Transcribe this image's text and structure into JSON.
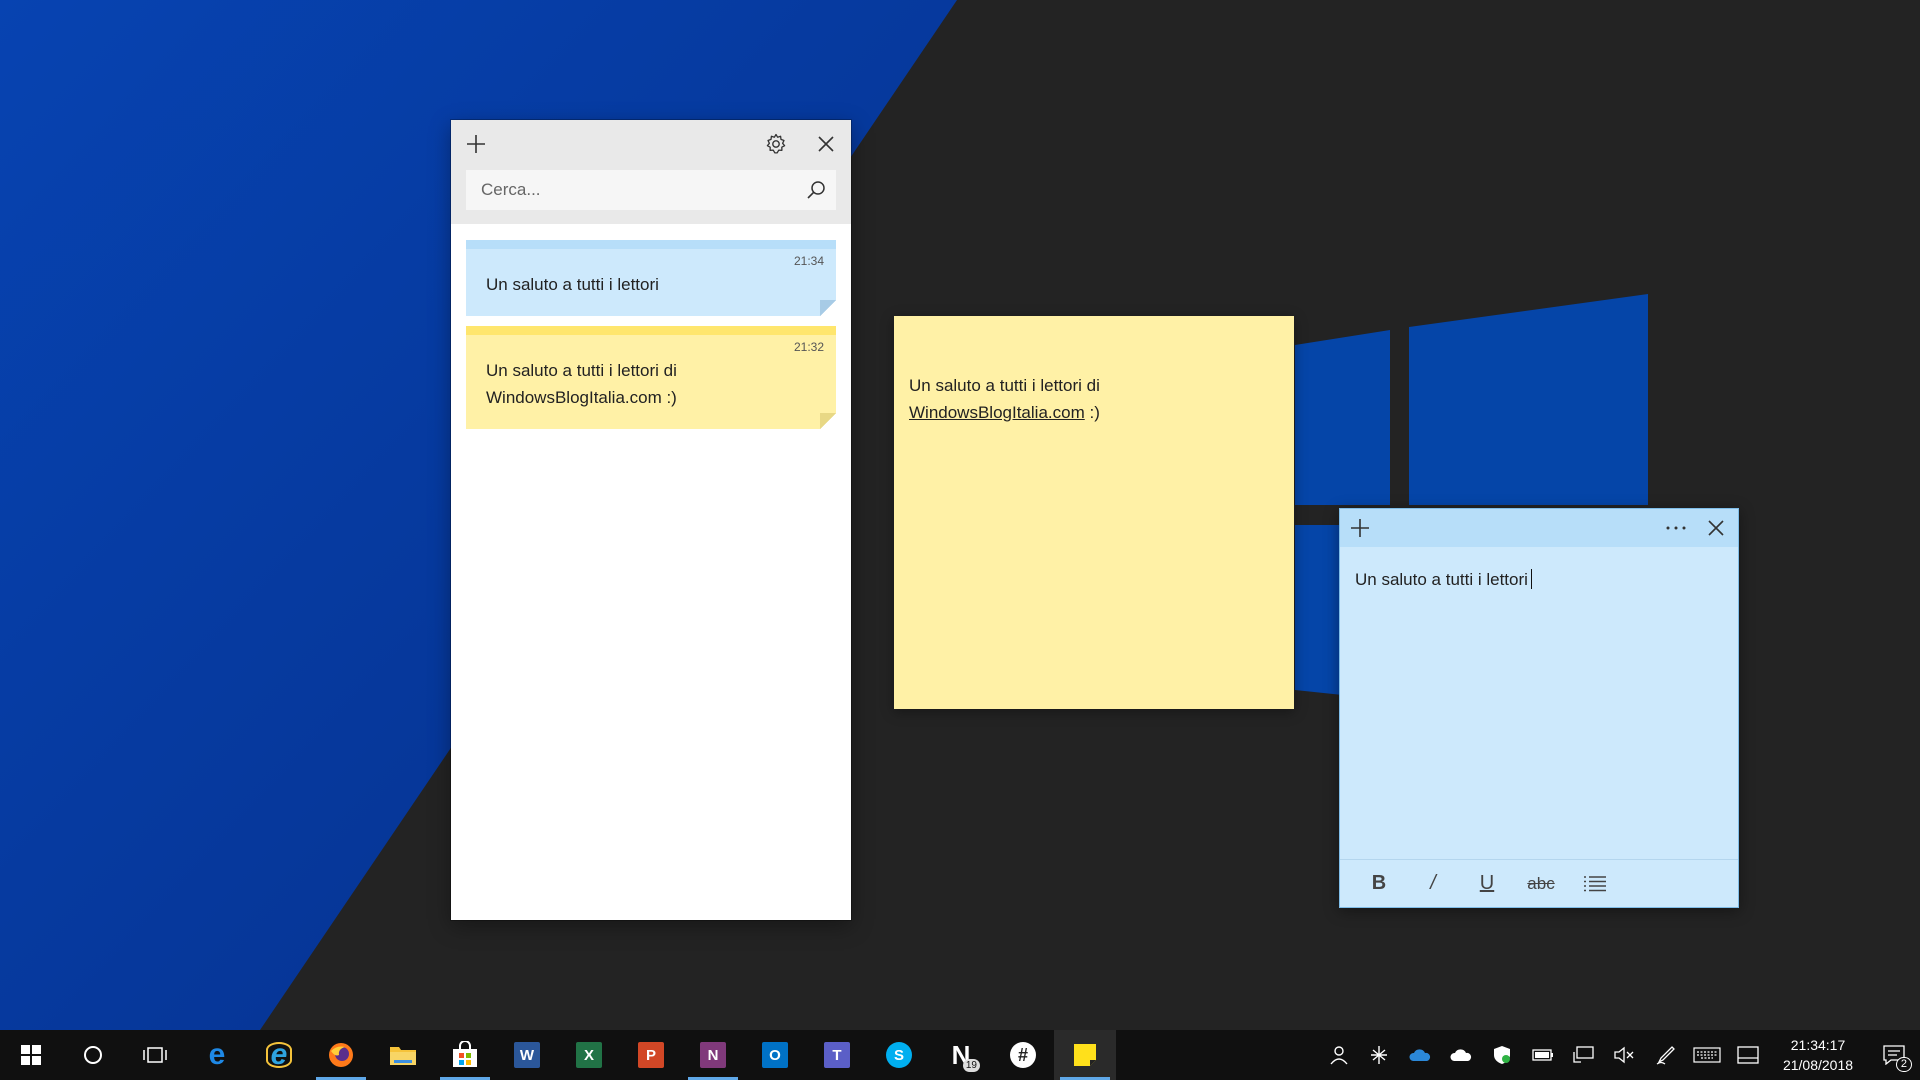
{
  "colors": {
    "wallpaper_dark": "#232323",
    "wallpaper_blue": "#0638a0",
    "note_yellow": "#fff1a6",
    "note_blue": "#cde9fc",
    "taskbar": "#101010",
    "accent": "#5fa8e8"
  },
  "notes_list": {
    "search": {
      "placeholder": "Cerca...",
      "value": ""
    },
    "buttons": {
      "new": "plus-icon",
      "settings": "gear-icon",
      "close": "close-icon"
    },
    "notes": [
      {
        "time": "21:34",
        "text": "Un saluto a tutti i lettori",
        "color": "blue"
      },
      {
        "time": "21:32",
        "text_line1": "Un saluto a tutti i lettori di",
        "text_line2": "WindowsBlogItalia.com :)",
        "color": "yellow"
      }
    ]
  },
  "yellow_note": {
    "line1": "Un saluto a tutti i lettori di",
    "link": "WindowsBlogItalia.com",
    "suffix": " :)"
  },
  "blue_note": {
    "text": "Un saluto a tutti i lettori",
    "title_buttons": [
      "plus-icon",
      "more-icon",
      "close-icon"
    ],
    "format": {
      "bold": "B",
      "italic": "/",
      "underline": "U",
      "strike": "abc",
      "bullets": "list-icon"
    }
  },
  "taskbar": {
    "apps": [
      {
        "name": "start",
        "icon": "windows-icon"
      },
      {
        "name": "cortana",
        "icon": "circle-icon"
      },
      {
        "name": "task-view",
        "icon": "task-view-icon"
      },
      {
        "name": "edge",
        "icon": "e",
        "color": "#1e88e5"
      },
      {
        "name": "internet-explorer",
        "icon": "e",
        "color": "#2ea3e0"
      },
      {
        "name": "firefox",
        "icon": "firefox-icon",
        "color": "#ff7a1a",
        "running": true
      },
      {
        "name": "file-explorer",
        "icon": "folder-icon",
        "color": "#f6c33a"
      },
      {
        "name": "store",
        "icon": "bag-icon",
        "color": "#0a6fd1",
        "running": true
      },
      {
        "name": "word",
        "icon": "W",
        "color": "#2b579a"
      },
      {
        "name": "excel",
        "icon": "X",
        "color": "#217346"
      },
      {
        "name": "powerpoint",
        "icon": "P",
        "color": "#d24726"
      },
      {
        "name": "onenote",
        "icon": "N",
        "color": "#80397b",
        "running": true
      },
      {
        "name": "outlook",
        "icon": "O",
        "color": "#0072c6"
      },
      {
        "name": "teams",
        "icon": "T",
        "color": "#5b5fc7"
      },
      {
        "name": "skype",
        "icon": "S",
        "color": "#00aff0"
      },
      {
        "name": "news",
        "icon": "N",
        "color": "#333333",
        "badge": "19"
      },
      {
        "name": "slack",
        "icon": "#",
        "color": "#ffffff"
      },
      {
        "name": "sticky-notes",
        "icon": "sticky-icon",
        "color": "#ffe01b",
        "active": true
      }
    ],
    "tray": [
      "people-icon",
      "bluetooth-icon",
      "onedrive-blue-icon",
      "onedrive-white-icon",
      "defender-icon",
      "battery-icon",
      "network-icon",
      "volume-muted-icon",
      "pen-icon",
      "keyboard-icon",
      "tablet-icon"
    ],
    "clock": {
      "time": "21:34:17",
      "date": "21/08/2018"
    },
    "notifications": {
      "icon": "action-center-icon",
      "count": "2"
    }
  }
}
